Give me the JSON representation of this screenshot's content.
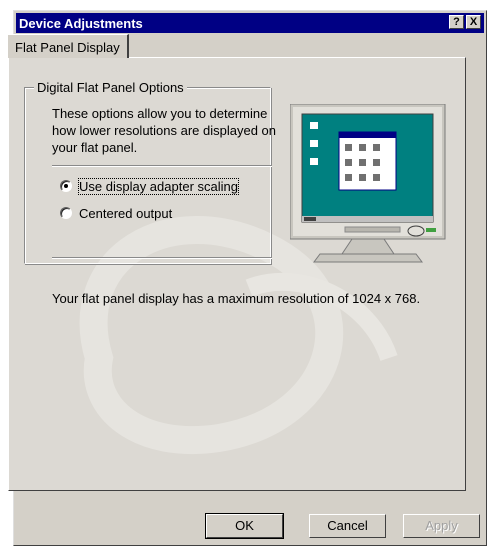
{
  "window": {
    "title": "Device Adjustments",
    "help_glyph": "?",
    "close_glyph": "X"
  },
  "tabs": [
    {
      "label": "Flat Panel Display"
    }
  ],
  "group": {
    "label": "Digital Flat Panel Options",
    "description": "These options allow you to determine how lower resolutions are displayed on your flat panel.",
    "options": [
      {
        "label": "Use display adapter scaling",
        "selected": true
      },
      {
        "label": "Centered output",
        "selected": false
      }
    ]
  },
  "info_text": "Your flat panel display has a maximum resolution of 1024 x 768.",
  "buttons": {
    "ok": "OK",
    "cancel": "Cancel",
    "apply": "Apply"
  },
  "colors": {
    "titlebar": "#000084",
    "face": "#d4d0c8",
    "desktop_teal": "#008080"
  }
}
